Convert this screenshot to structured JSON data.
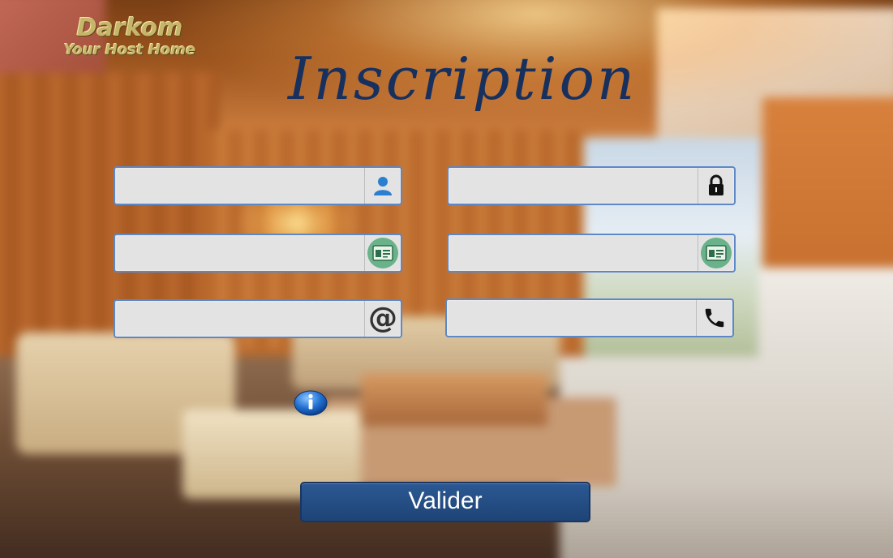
{
  "logo": {
    "name": "Darkom",
    "tagline": "Your Host Home"
  },
  "title": "Inscription",
  "fields": [
    {
      "id": "username",
      "value": "",
      "icon": "user-icon"
    },
    {
      "id": "password",
      "value": "",
      "icon": "lock-icon"
    },
    {
      "id": "id-card-1",
      "value": "",
      "icon": "id-card-icon"
    },
    {
      "id": "id-card-2",
      "value": "",
      "icon": "id-card-icon"
    },
    {
      "id": "email",
      "value": "",
      "icon": "at-icon"
    },
    {
      "id": "phone",
      "value": "",
      "icon": "phone-icon"
    }
  ],
  "info_icon": "info-icon",
  "submit_label": "Valider",
  "colors": {
    "field_border": "#5d88c8",
    "field_bg": "#e3e3e3",
    "button_bg": "#2b5893",
    "title": "#18305e"
  }
}
